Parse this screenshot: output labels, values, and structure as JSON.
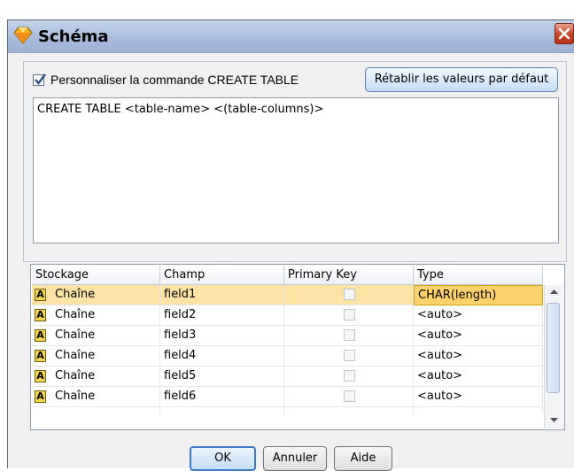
{
  "window": {
    "title": "Schéma",
    "close_label": "×"
  },
  "create_table": {
    "checkbox_label": "Personnaliser la commande CREATE TABLE",
    "checked": true,
    "reset_button": "Rétablir les valeurs par défaut",
    "sql_text": "CREATE TABLE <table-name> <(table-columns)>"
  },
  "grid": {
    "columns": [
      "Stockage",
      "Champ",
      "Primary Key",
      "Type"
    ],
    "type_icon": "A",
    "rows": [
      {
        "storage": "Chaîne",
        "field": "field1",
        "primary_key": false,
        "type": "CHAR(length)",
        "selected": true
      },
      {
        "storage": "Chaîne",
        "field": "field2",
        "primary_key": false,
        "type": "<auto>"
      },
      {
        "storage": "Chaîne",
        "field": "field3",
        "primary_key": false,
        "type": "<auto>"
      },
      {
        "storage": "Chaîne",
        "field": "field4",
        "primary_key": false,
        "type": "<auto>"
      },
      {
        "storage": "Chaîne",
        "field": "field5",
        "primary_key": false,
        "type": "<auto>"
      },
      {
        "storage": "Chaîne",
        "field": "field6",
        "primary_key": false,
        "type": "<auto>"
      }
    ]
  },
  "buttons": {
    "ok": "OK",
    "cancel": "Annuler",
    "help": "Aide"
  },
  "colors": {
    "selected_row": "#fbe3a5",
    "title_bar": "#a7bcd9",
    "close_button": "#c7442a"
  }
}
